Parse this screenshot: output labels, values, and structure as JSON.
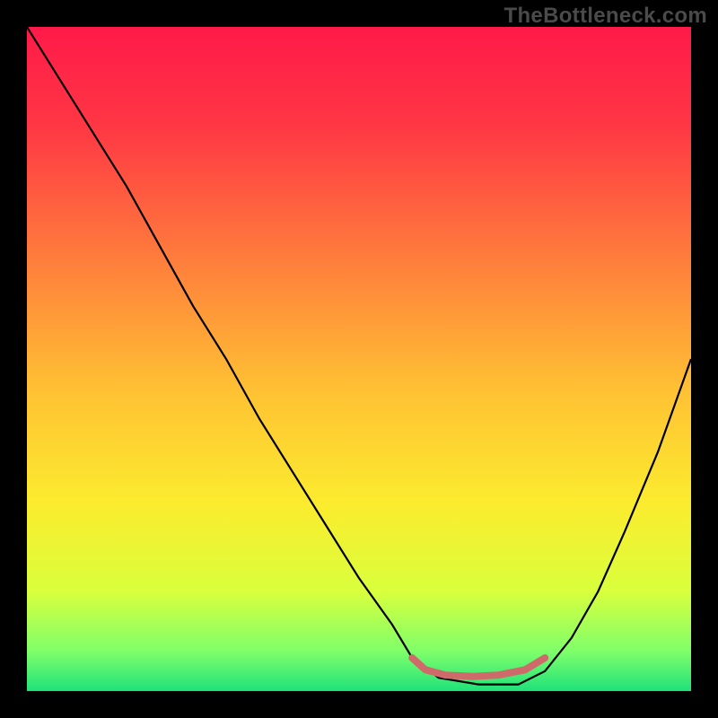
{
  "watermark": "TheBottleneck.com",
  "chart_data": {
    "type": "line",
    "title": "",
    "xlabel": "",
    "ylabel": "",
    "xlim": [
      0,
      100
    ],
    "ylim": [
      0,
      100
    ],
    "background_gradient": {
      "stops": [
        {
          "offset": 0,
          "color": "#ff1a49"
        },
        {
          "offset": 15,
          "color": "#ff3744"
        },
        {
          "offset": 35,
          "color": "#ff7d3c"
        },
        {
          "offset": 55,
          "color": "#ffc233"
        },
        {
          "offset": 72,
          "color": "#fbec2e"
        },
        {
          "offset": 85,
          "color": "#d9ff3c"
        },
        {
          "offset": 94,
          "color": "#7fff6a"
        },
        {
          "offset": 100,
          "color": "#1fe27a"
        }
      ]
    },
    "series": [
      {
        "name": "bottleneck-curve",
        "x": [
          0,
          5,
          10,
          15,
          20,
          25,
          30,
          35,
          40,
          45,
          50,
          55,
          58,
          62,
          68,
          74,
          78,
          82,
          86,
          90,
          95,
          100
        ],
        "y": [
          100,
          92,
          84,
          76,
          67,
          58,
          50,
          41,
          33,
          25,
          17,
          10,
          5,
          2,
          1,
          1,
          3,
          8,
          15,
          24,
          36,
          50
        ]
      }
    ],
    "bottleneck_highlight": {
      "name": "bottleneck-flat-region",
      "points": [
        {
          "x": 58,
          "y": 5
        },
        {
          "x": 60,
          "y": 3.2
        },
        {
          "x": 63,
          "y": 2.4
        },
        {
          "x": 67,
          "y": 2.2
        },
        {
          "x": 71,
          "y": 2.4
        },
        {
          "x": 75,
          "y": 3.2
        },
        {
          "x": 78,
          "y": 5
        }
      ],
      "thickness_px": 8
    }
  }
}
